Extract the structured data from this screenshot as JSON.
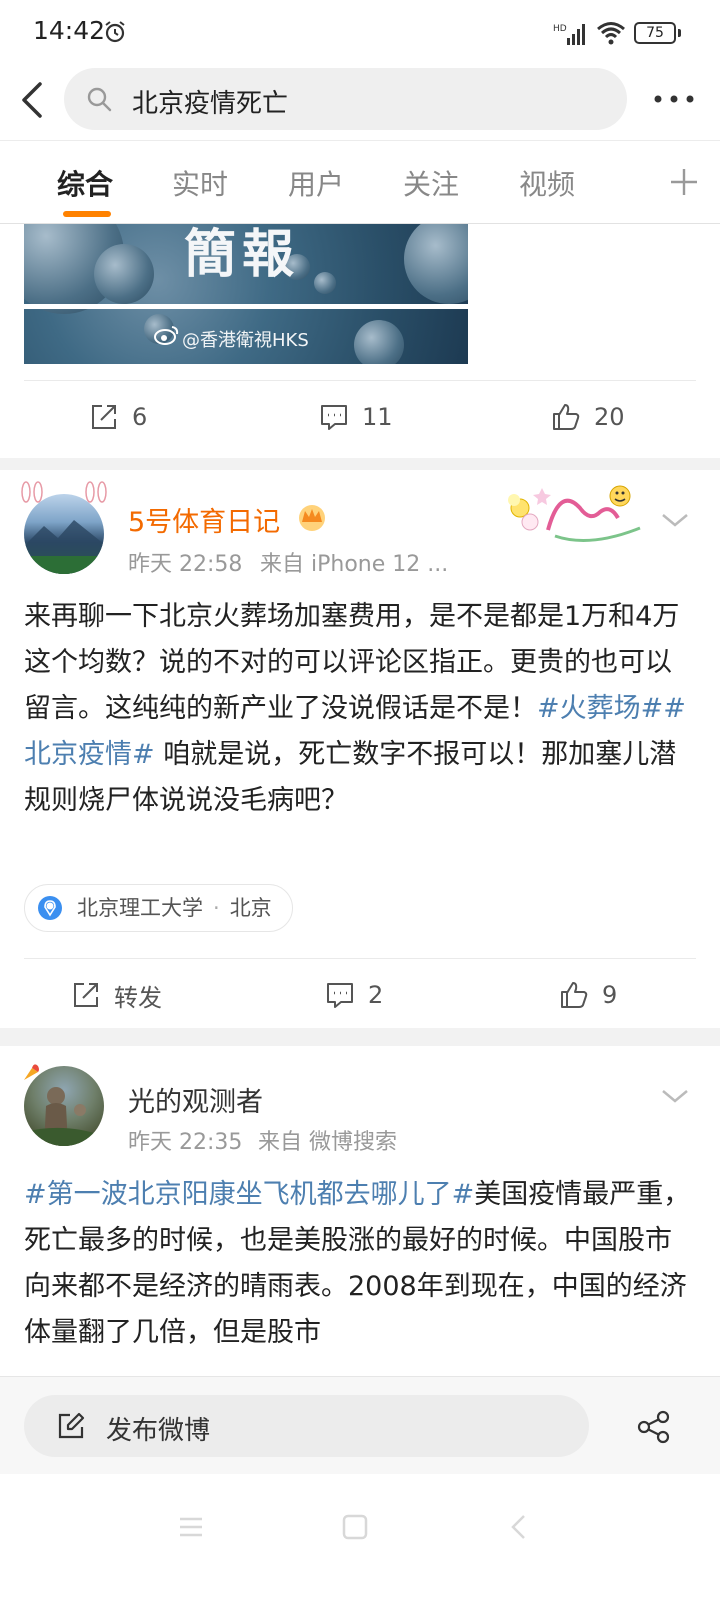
{
  "status_bar": {
    "time": "14:42",
    "battery": "75",
    "network": "HD"
  },
  "search": {
    "query": "北京疫情死亡"
  },
  "tabs": [
    {
      "label": "综合",
      "active": true
    },
    {
      "label": "实时"
    },
    {
      "label": "用户"
    },
    {
      "label": "关注"
    },
    {
      "label": "视频"
    }
  ],
  "posts": [
    {
      "image_text": "簡報",
      "image_watermark": "@香港衛視HKS",
      "repost_count": "6",
      "comment_count": "11",
      "like_count": "20"
    },
    {
      "username": "5号体育日记",
      "time": "昨天 22:58",
      "source": "来自 iPhone 12 ...",
      "text_before": "来再聊一下北京火葬场加塞费用，是不是都是1万和4万这个均数？说的不对的可以评论区指正。更贵的也可以留言。这纯纯的新产业了没说假话是不是！",
      "hashtags": [
        "#火葬场#",
        "#北京疫情#"
      ],
      "text_after": " 咱就是说，死亡数字不报可以！那加塞儿潜规则烧尸体说说没毛病吧？",
      "location": "北京理工大学",
      "city": "北京",
      "repost_label": "转发",
      "comment_count": "2",
      "like_count": "9"
    },
    {
      "username": "光的观测者",
      "time": "昨天 22:35",
      "source": "来自 微博搜索",
      "hashtag": "#第一波北京阳康坐飞机都去哪儿了#",
      "text": "美国疫情最严重，死亡最多的时候，也是美股涨的最好的时候。中国股市向来都不是经济的晴雨表。2008年到现在，中国的经济体量翻了几倍，但是股市"
    }
  ],
  "compose": {
    "label": "发布微博"
  },
  "colors": {
    "accent": "#ff8200",
    "link": "#4d7fb0",
    "vip_name": "#f36a00"
  }
}
